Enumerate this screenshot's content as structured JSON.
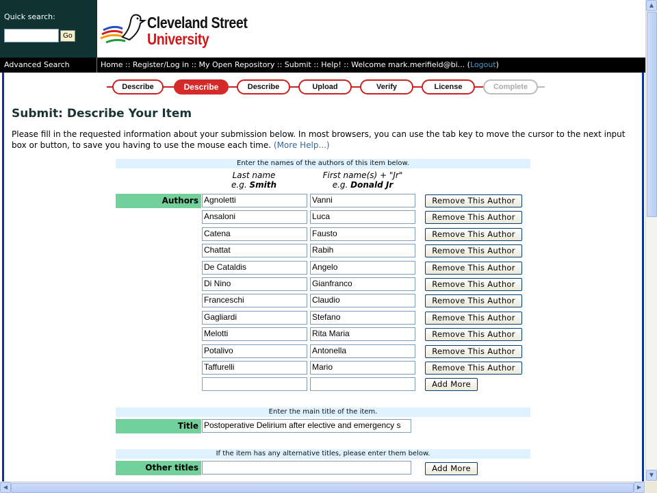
{
  "quick_search": {
    "label": "Quick search:",
    "value": "",
    "go_label": "Go"
  },
  "logo": {
    "line1": "Cleveland Street",
    "line2": "University"
  },
  "nav": {
    "advanced_search": "Advanced Search",
    "links": [
      "Home",
      "Register/Log in",
      "My Open Repository",
      "Submit",
      "Help!"
    ],
    "separator": "::",
    "welcome": "Welcome mark.merifield@bi...",
    "logout": "Logout"
  },
  "progress_steps": [
    {
      "label": "Describe",
      "state": "done"
    },
    {
      "label": "Describe",
      "state": "current"
    },
    {
      "label": "Describe",
      "state": "done"
    },
    {
      "label": "Upload",
      "state": "done"
    },
    {
      "label": "Verify",
      "state": "done"
    },
    {
      "label": "License",
      "state": "done"
    },
    {
      "label": "Complete",
      "state": "disabled"
    }
  ],
  "page_title": "Submit: Describe Your Item",
  "intro": "Please fill in the requested information about your submission below. In most browsers, you can use the tab key to move the cursor to the next input box or button, to save you having to use the mouse each time.",
  "more_help": "(More Help...)",
  "authors": {
    "banner": "Enter the names of the authors of this item below.",
    "last_hint": "Last name",
    "last_example": "e.g. ",
    "last_example_bold": "Smith",
    "first_hint": "First name(s) + \"Jr\"",
    "first_example": "e.g. ",
    "first_example_bold": "Donald Jr",
    "label": "Authors",
    "remove_label": "Remove This Author",
    "add_label": "Add More",
    "list": [
      {
        "last": "Agnoletti",
        "first": "Vanni"
      },
      {
        "last": "Ansaloni",
        "first": "Luca"
      },
      {
        "last": "Catena",
        "first": "Fausto"
      },
      {
        "last": "Chattat",
        "first": "Rabih"
      },
      {
        "last": "De Cataldis",
        "first": "Angelo"
      },
      {
        "last": "Di Nino",
        "first": "Gianfranco"
      },
      {
        "last": "Franceschi",
        "first": "Claudio"
      },
      {
        "last": "Gagliardi",
        "first": "Stefano"
      },
      {
        "last": "Melotti",
        "first": "Rita Maria"
      },
      {
        "last": "Potalivo",
        "first": "Antonella"
      },
      {
        "last": "Taffurelli",
        "first": "Mario"
      }
    ]
  },
  "title_field": {
    "banner": "Enter the main title of the item.",
    "label": "Title",
    "value": "Postoperative Delirium after elective and emergency s"
  },
  "other_titles": {
    "banner": "If the item has any alternative titles, please enter them below.",
    "label": "Other titles",
    "value": "",
    "add_label": "Add More"
  },
  "colors": {
    "header_bg": "#0f3333",
    "nav_bg": "#000000",
    "step_red": "#cc2020",
    "label_green": "#72d09a",
    "banner_blue": "#def2ff",
    "frame_blue": "#0f3399"
  }
}
